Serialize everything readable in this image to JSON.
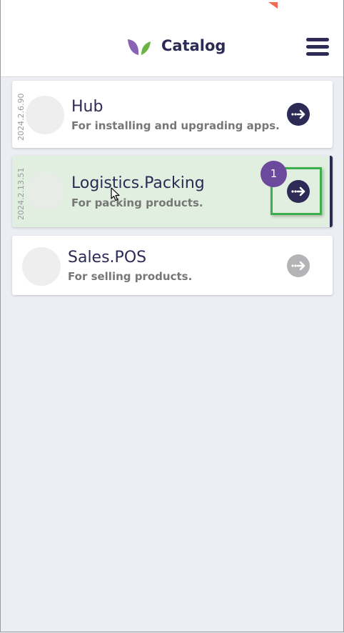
{
  "header": {
    "title": "Catalog",
    "logo_colors": [
      "#8b63b5",
      "#6bb345"
    ]
  },
  "apps": [
    {
      "version": "2024.2.6.90",
      "name": "Hub",
      "description": "For installing and upgrading apps.",
      "selected": false,
      "button_enabled": true
    },
    {
      "version": "2024.2.13.51",
      "name": "Logistics.Packing",
      "description": "For packing products.",
      "selected": true,
      "button_enabled": true
    },
    {
      "version": "",
      "name": "Sales.POS",
      "description": "For selling products.",
      "selected": false,
      "button_enabled": false
    }
  ],
  "annotation": {
    "step_number": "1"
  },
  "colors": {
    "primary": "#2d2a55",
    "selected_bg": "#e0efdf",
    "highlight": "#3cae4b",
    "badge": "#6b4a9e",
    "disabled": "#b4b4b6"
  }
}
